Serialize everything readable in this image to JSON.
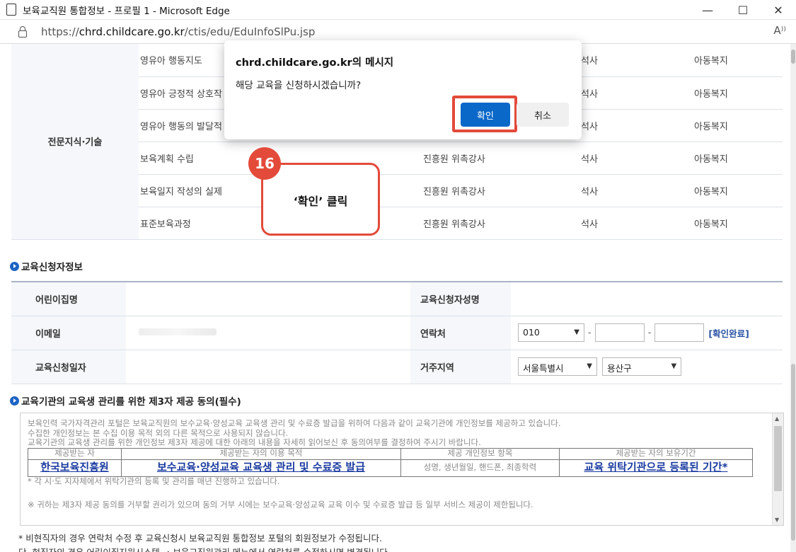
{
  "window": {
    "title": "보육교직원 통합정보 - 프로필 1 - Microsoft Edge",
    "url_prefix": "https://",
    "url_domain": "chrd.childcare.go.kr",
    "url_path": "/ctis/edu/EduInfoSlPu.jsp",
    "controls": {
      "minimize": "—",
      "maximize": "☐",
      "close": "✕"
    },
    "read_aloud": "A⁾⁾"
  },
  "courses": {
    "category": "전문지식·기술",
    "rows": [
      {
        "name": "영유아 행동지도",
        "instructor": "",
        "degree": "석사",
        "field": "아동복지"
      },
      {
        "name": "영유아 긍정적 상호작",
        "instructor": "",
        "degree": "석사",
        "field": "아동복지"
      },
      {
        "name": "영유아 행동의 발달적",
        "instructor": "",
        "degree": "석사",
        "field": "아동복지"
      },
      {
        "name": "보육계획 수립",
        "instructor": "진흥원 위촉강사",
        "degree": "석사",
        "field": "아동복지"
      },
      {
        "name": "보육일지 작성의 실제",
        "instructor": "진흥원 위촉강사",
        "degree": "석사",
        "field": "아동복지"
      },
      {
        "name": "표준보육과정",
        "instructor": "진흥원 위촉강사",
        "degree": "석사",
        "field": "아동복지"
      }
    ]
  },
  "applicant": {
    "section_title": "교육신청자정보",
    "daycare_label": "어린이집명",
    "applicant_name_label": "교육신청자성명",
    "email_label": "이메일",
    "phone_label": "연락처",
    "phone_prefix": "010",
    "phone_confirm": "[확인완료]",
    "date_label": "교육신청일자",
    "region_label": "거주지역",
    "city": "서울특별시",
    "district": "용산구"
  },
  "consent": {
    "section_title": "교육기관의 교육생 관리를 위한 제3자 제공 동의(필수)",
    "line1": "보육인력 국가자격관리 포털은 보육교직원의 보수교육·양성교육 교육생 관리 및 수료증 발급을 위하여 다음과 같이 교육기관에 개인정보를 제공하고 있습니다.",
    "line2": "수집한 개인정보는 본 수집 이용 목적 외의 다른 목적으로 사용되지 않습니다.",
    "line3": "교육기관의 교육생 관리를 위한 개인정보 제3자 제공에 대한 아래의 내용을 자세히 읽어보신 후 동의여부를 결정하여 주시기 바랍니다.",
    "headers": [
      "제공받는 자",
      "제공받는 자의 이용 목적",
      "제공 개인정보 항목",
      "제공받는 자의 보유기간"
    ],
    "recipient": "한국보육진흥원",
    "purpose": "보수교육·양성교육 교육생 관리 및 수료증 발급",
    "items": "성명, 생년월일, 핸드폰, 최종학력",
    "period": "교육 위탁기관으로 등록된 기간*",
    "note1": "* 각 시·도 지자체에서 위탁기관의 등록 및 관리를 매년 진행하고 있습니다.",
    "note2": "※ 귀하는 제3자 제공 동의를 거부할 권리가 있으며 동의 거부 시에는 보수교육·양성교육 교육 이수 및 수료증 발급 등 일부 서비스 제공이 제한됩니다.",
    "scroll_up": "▲",
    "scroll_down": "▼"
  },
  "footer": {
    "note1": "* 비현직자의 경우 연락처 수정 후 교육신청시 보육교직원 통합정보 포털의 회원정보가 수정됩니다.",
    "note2": "단, 현직자의 경우 어린이집지원시스템 → 보육교직원관리 메뉴에서 연락처를 수정하시면 변경됩니다."
  },
  "dialog": {
    "title": "chrd.childcare.go.kr의 메시지",
    "message": "해당 교육을 신청하시겠습니까?",
    "ok_label": "확인",
    "cancel_label": "취소"
  },
  "annotation": {
    "step_number": "16",
    "text": "‘확인’ 클릭",
    "color": "#e34a3a"
  },
  "colors": {
    "ok_button": "#0a68c9",
    "bullet": "#1d63c4",
    "link": "#1a3aa0"
  }
}
